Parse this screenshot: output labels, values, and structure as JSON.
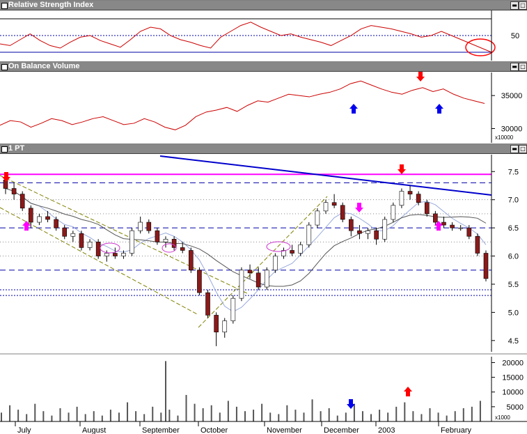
{
  "panels": {
    "rsi": {
      "title": "Relative Strength Index",
      "ticks": [
        "50"
      ]
    },
    "obv": {
      "title": "On Balance Volume",
      "ticks": [
        "35000",
        "30000"
      ],
      "multiplier": "x10000"
    },
    "price": {
      "title": "1 PT",
      "ticks": [
        "7.5",
        "7.0",
        "6.5",
        "6.0",
        "5.5",
        "5.0",
        "4.5"
      ]
    },
    "volume": {
      "ticks": [
        "20000",
        "15000",
        "10000",
        "5000"
      ],
      "multiplier": "x1000"
    }
  },
  "months": [
    "July",
    "August",
    "September",
    "October",
    "November",
    "December",
    "2003",
    "February"
  ],
  "window_buttons": {
    "minimize": "▬",
    "maximize": "□"
  },
  "colors": {
    "up": "#ffffff",
    "down": "#8b1a1a",
    "rsi": "#cc0000",
    "obv": "#cc0000",
    "trend": "#0000cc",
    "resistance": "#ff00ff",
    "arrow_red": "#ff0000",
    "arrow_blue": "#0000ee",
    "arrow_magenta": "#ff00ff"
  },
  "chart_data": [
    {
      "type": "line",
      "series": [
        {
          "values": [
            40,
            38,
            45,
            52,
            44,
            38,
            35,
            42,
            48,
            50,
            44,
            40,
            36,
            45,
            55,
            60,
            58,
            50,
            45,
            42,
            38,
            35,
            48,
            55,
            62,
            66,
            60,
            55,
            50,
            52,
            48,
            45,
            42,
            38,
            44,
            50,
            58,
            62,
            60,
            58,
            55,
            52,
            48,
            50,
            55,
            50,
            45,
            40,
            35,
            30
          ]
        }
      ],
      "ylim": [
        20,
        80
      ],
      "reference_lines": [
        70,
        50,
        30
      ]
    },
    {
      "type": "line",
      "series": [
        {
          "values": [
            30500,
            31200,
            31000,
            30200,
            30800,
            31500,
            31200,
            30600,
            31000,
            31500,
            31800,
            31200,
            30600,
            30800,
            31500,
            31000,
            30200,
            29800,
            30500,
            31800,
            32500,
            32800,
            33200,
            32600,
            33500,
            34200,
            34000,
            34600,
            35200,
            35000,
            34800,
            35200,
            35500,
            36000,
            36800,
            37200,
            36600,
            36000,
            35500,
            35200,
            35800,
            36200,
            35600,
            36000,
            35200,
            34600,
            34200,
            33800
          ]
        }
      ],
      "ylim": [
        29000,
        38500
      ]
    },
    {
      "type": "candlestick",
      "ohlc": [
        [
          7.35,
          7.4,
          7.1,
          7.2
        ],
        [
          7.2,
          7.3,
          7.0,
          7.1
        ],
        [
          7.1,
          7.15,
          6.8,
          6.85
        ],
        [
          6.85,
          6.9,
          6.5,
          6.6
        ],
        [
          6.6,
          6.75,
          6.55,
          6.7
        ],
        [
          6.7,
          6.8,
          6.6,
          6.65
        ],
        [
          6.65,
          6.7,
          6.45,
          6.5
        ],
        [
          6.5,
          6.55,
          6.3,
          6.35
        ],
        [
          6.35,
          6.45,
          6.25,
          6.4
        ],
        [
          6.4,
          6.45,
          6.1,
          6.15
        ],
        [
          6.15,
          6.3,
          6.1,
          6.25
        ],
        [
          6.25,
          6.3,
          5.95,
          6.0
        ],
        [
          6.0,
          6.1,
          5.9,
          6.05
        ],
        [
          6.05,
          6.15,
          5.95,
          6.0
        ],
        [
          6.0,
          6.1,
          5.95,
          6.05
        ],
        [
          6.05,
          6.5,
          6.0,
          6.45
        ],
        [
          6.45,
          6.7,
          6.4,
          6.6
        ],
        [
          6.6,
          6.65,
          6.4,
          6.45
        ],
        [
          6.45,
          6.5,
          6.2,
          6.25
        ],
        [
          6.25,
          6.35,
          6.15,
          6.3
        ],
        [
          6.3,
          6.35,
          6.1,
          6.15
        ],
        [
          6.15,
          6.25,
          6.05,
          6.1
        ],
        [
          6.1,
          6.15,
          5.7,
          5.75
        ],
        [
          5.75,
          5.8,
          5.3,
          5.35
        ],
        [
          5.35,
          5.4,
          4.9,
          4.95
        ],
        [
          4.95,
          5.0,
          4.4,
          4.65
        ],
        [
          4.65,
          4.9,
          4.55,
          4.85
        ],
        [
          4.85,
          5.3,
          4.8,
          5.25
        ],
        [
          5.25,
          5.8,
          5.2,
          5.75
        ],
        [
          5.75,
          5.85,
          5.6,
          5.7
        ],
        [
          5.7,
          5.8,
          5.4,
          5.45
        ],
        [
          5.45,
          5.8,
          5.4,
          5.75
        ],
        [
          5.75,
          6.05,
          5.7,
          6.0
        ],
        [
          6.0,
          6.15,
          5.95,
          6.1
        ],
        [
          6.1,
          6.2,
          6.0,
          6.05
        ],
        [
          6.05,
          6.25,
          6.0,
          6.2
        ],
        [
          6.2,
          6.6,
          6.15,
          6.55
        ],
        [
          6.55,
          6.85,
          6.5,
          6.8
        ],
        [
          6.8,
          7.0,
          6.75,
          6.95
        ],
        [
          6.95,
          7.1,
          6.85,
          6.9
        ],
        [
          6.9,
          6.95,
          6.6,
          6.65
        ],
        [
          6.65,
          6.7,
          6.35,
          6.45
        ],
        [
          6.45,
          6.55,
          6.3,
          6.4
        ],
        [
          6.4,
          6.5,
          6.3,
          6.45
        ],
        [
          6.45,
          6.5,
          6.2,
          6.3
        ],
        [
          6.3,
          6.7,
          6.25,
          6.65
        ],
        [
          6.65,
          6.95,
          6.6,
          6.9
        ],
        [
          6.9,
          7.2,
          6.85,
          7.15
        ],
        [
          7.15,
          7.25,
          7.0,
          7.1
        ],
        [
          7.1,
          7.15,
          6.9,
          6.95
        ],
        [
          6.95,
          7.0,
          6.7,
          6.75
        ],
        [
          6.75,
          6.8,
          6.55,
          6.6
        ],
        [
          6.6,
          6.7,
          6.5,
          6.55
        ],
        [
          6.55,
          6.6,
          6.45,
          6.5
        ],
        [
          6.5,
          6.55,
          6.45,
          6.5
        ],
        [
          6.5,
          6.55,
          6.3,
          6.35
        ],
        [
          6.35,
          6.4,
          6.0,
          6.05
        ],
        [
          6.05,
          6.1,
          5.55,
          5.6
        ]
      ],
      "ylim": [
        4.3,
        7.8
      ],
      "horizontal_lines": [
        7.45,
        7.3,
        6.5,
        5.75,
        5.4,
        5.3
      ],
      "trend_lines": [
        [
          [
            0,
            8.1
          ],
          [
            57,
            7.0
          ]
        ]
      ]
    },
    {
      "type": "bar",
      "series": [
        {
          "values": [
            3000,
            5500,
            4000,
            2500,
            6000,
            3500,
            2000,
            4500,
            3000,
            5000,
            2500,
            3500,
            2000,
            4000,
            3000,
            6500,
            3500,
            2500,
            5000,
            3000,
            4000,
            2000,
            9000,
            6000,
            4500,
            5500,
            3000,
            7000,
            5000,
            3500,
            4000,
            6000,
            3000,
            2500,
            5500,
            4000,
            3000,
            7500,
            3500,
            4500,
            2000,
            3000,
            6000,
            3500,
            2500,
            4000,
            3000,
            5000,
            6500,
            3500,
            2500,
            4500,
            3000,
            2000,
            3500,
            4500,
            5000,
            7000
          ]
        }
      ],
      "ylim": [
        0,
        22000
      ],
      "spike": 20500
    }
  ]
}
